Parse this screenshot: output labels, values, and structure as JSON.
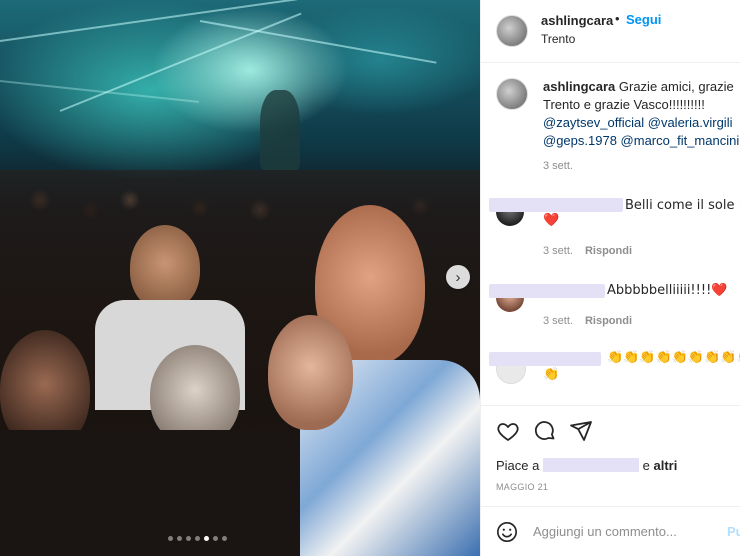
{
  "post": {
    "username": "ashlingcara",
    "follow_dot": "•",
    "follow_label": "Segui",
    "location": "Trento"
  },
  "caption": {
    "username": "ashlingcara",
    "text": "Grazie amici, grazie Trento e grazie Vasco!!!!!!!!!!",
    "mentions": [
      "@zaytsev_official",
      "@valeria.virgili",
      "@geps.1978",
      "@marco_fit_mancini"
    ],
    "time": "3 sett."
  },
  "comments": [
    {
      "text": "Belli come il sole 🙌",
      "text2": "❤️",
      "time": "3 sett.",
      "reply": "Rispondi"
    },
    {
      "text": "Abbbbbelliiiii!!!!❤️",
      "time": "3 sett.",
      "reply": "Rispondi"
    },
    {
      "text": "👏👏👏👏👏👏👏👏👏",
      "text2": "👏"
    }
  ],
  "photo": {
    "nav_next": "›",
    "dots_total": 7,
    "dots_active": 5
  },
  "actions": {
    "like_icon": "heart-icon",
    "comment_icon": "comment-icon",
    "share_icon": "share-icon"
  },
  "likes": {
    "prefix": "Piace a",
    "suffix": "e",
    "others": "altri"
  },
  "date": "MAGGIO 21",
  "comment_input": {
    "placeholder": "Aggiungi un commento...",
    "post_label": "Pu"
  }
}
